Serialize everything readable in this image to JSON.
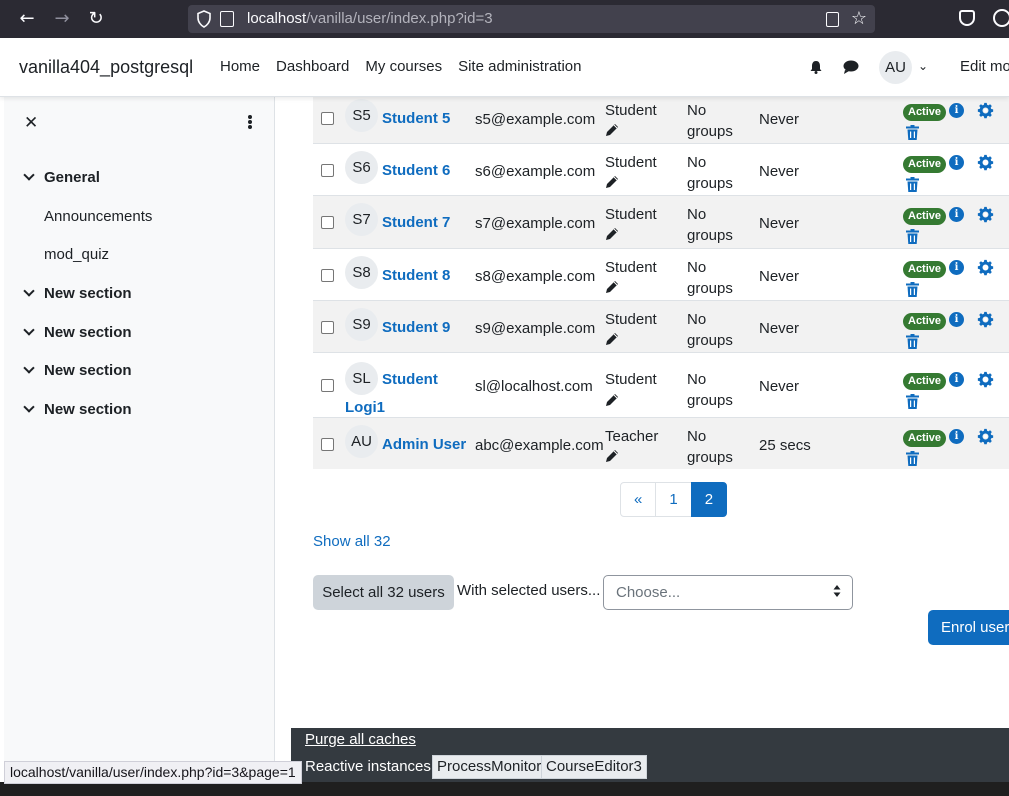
{
  "browser": {
    "url_host": "localhost",
    "url_path": "/vanilla/user/index.php?id=3",
    "status_url": "localhost/vanilla/user/index.php?id=3&page=1"
  },
  "navbar": {
    "brand": "vanilla404_postgresql",
    "links": [
      "Home",
      "Dashboard",
      "My courses",
      "Site administration"
    ],
    "avatar_initials": "AU",
    "edit_mode_label": "Edit mo"
  },
  "drawer": {
    "sections": [
      {
        "label": "General"
      },
      {
        "label": "New section"
      },
      {
        "label": "New section"
      },
      {
        "label": "New section"
      },
      {
        "label": "New section"
      }
    ],
    "activities": [
      "Announcements",
      "mod_quiz"
    ]
  },
  "participants": {
    "rows": [
      {
        "initials": "S5",
        "name": "Student 5",
        "email": "s5@example.com",
        "role": "Student",
        "groups_line1": "No",
        "groups_line2": "groups",
        "last_access": "Never",
        "status": "Active"
      },
      {
        "initials": "S6",
        "name": "Student 6",
        "email": "s6@example.com",
        "role": "Student",
        "groups_line1": "No",
        "groups_line2": "groups",
        "last_access": "Never",
        "status": "Active"
      },
      {
        "initials": "S7",
        "name": "Student 7",
        "email": "s7@example.com",
        "role": "Student",
        "groups_line1": "No",
        "groups_line2": "groups",
        "last_access": "Never",
        "status": "Active"
      },
      {
        "initials": "S8",
        "name": "Student 8",
        "email": "s8@example.com",
        "role": "Student",
        "groups_line1": "No",
        "groups_line2": "groups",
        "last_access": "Never",
        "status": "Active"
      },
      {
        "initials": "S9",
        "name": "Student 9",
        "email": "s9@example.com",
        "role": "Student",
        "groups_line1": "No",
        "groups_line2": "groups",
        "last_access": "Never",
        "status": "Active"
      },
      {
        "initials": "SL",
        "name_line1": "Student",
        "name_line2": "Logi1",
        "email": "sl@localhost.com",
        "role": "Student",
        "groups_line1": "No",
        "groups_line2": "groups",
        "last_access": "Never",
        "status": "Active"
      },
      {
        "initials": "AU",
        "name": "Admin User",
        "email": "abc@example.com",
        "role": "Teacher",
        "groups_line1": "No",
        "groups_line2": "groups",
        "last_access": "25 secs",
        "status": "Active"
      }
    ]
  },
  "pagination": {
    "prev": "«",
    "pages": [
      "1",
      "2"
    ],
    "current": "2"
  },
  "actions": {
    "show_all": "Show all 32",
    "select_all": "Select all 32 users",
    "with_selected": "With selected users...",
    "choose_placeholder": "Choose...",
    "enrol": "Enrol users"
  },
  "footer": {
    "purge": "Purge all caches",
    "reactive_label": "Reactive instances:",
    "instances": [
      "ProcessMonitor",
      "CourseEditor3"
    ]
  },
  "colors": {
    "accent": "#0f6cbf",
    "active_badge": "#357a32",
    "footer_bg": "#343a40"
  }
}
